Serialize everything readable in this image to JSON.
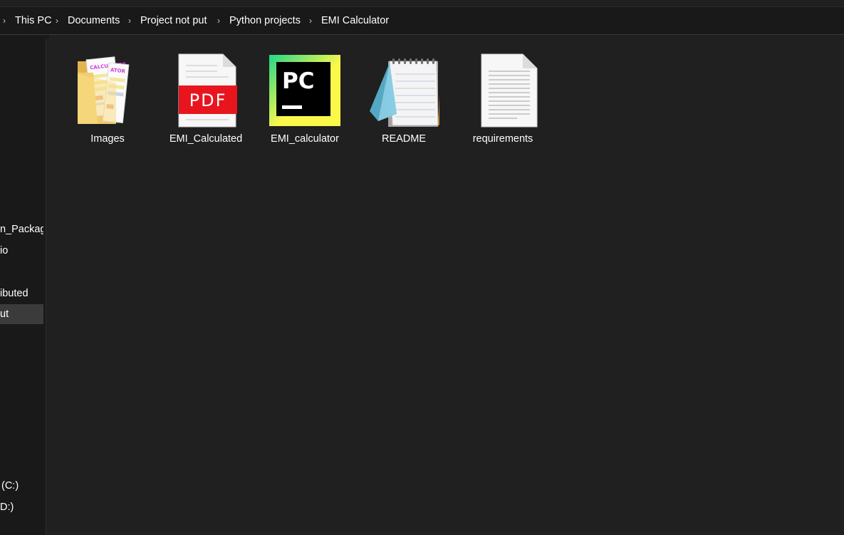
{
  "breadcrumb": {
    "items": [
      "This PC",
      "Documents",
      "Project not put",
      "Python projects",
      "EMI Calculator"
    ]
  },
  "sidebar": {
    "items": [
      {
        "label": "n_Package"
      },
      {
        "label": "io"
      },
      {
        "label": "ibuted"
      },
      {
        "label": "ut"
      },
      {
        "label": "(C:)"
      },
      {
        "label": "D:)"
      }
    ],
    "selected": "ut"
  },
  "files": [
    {
      "name": "Images",
      "icon": "folder-icon"
    },
    {
      "name": "EMI_Calculated",
      "icon": "pdf-icon",
      "badge": "PDF"
    },
    {
      "name": "EMI_calculator",
      "icon": "pycharm-icon",
      "badge": "PC"
    },
    {
      "name": "README",
      "icon": "notepad-icon"
    },
    {
      "name": "requirements",
      "icon": "text-file-icon"
    }
  ],
  "folder_thumb_text": [
    "CALCULATOR",
    "ATOR"
  ],
  "colors": {
    "background": "#202020",
    "address_bar": "#191919",
    "selected_nav": "#3b3b3b",
    "pdf_red": "#e8151e",
    "pycharm_green": "#21d789",
    "pycharm_yellow": "#fcf84a"
  }
}
